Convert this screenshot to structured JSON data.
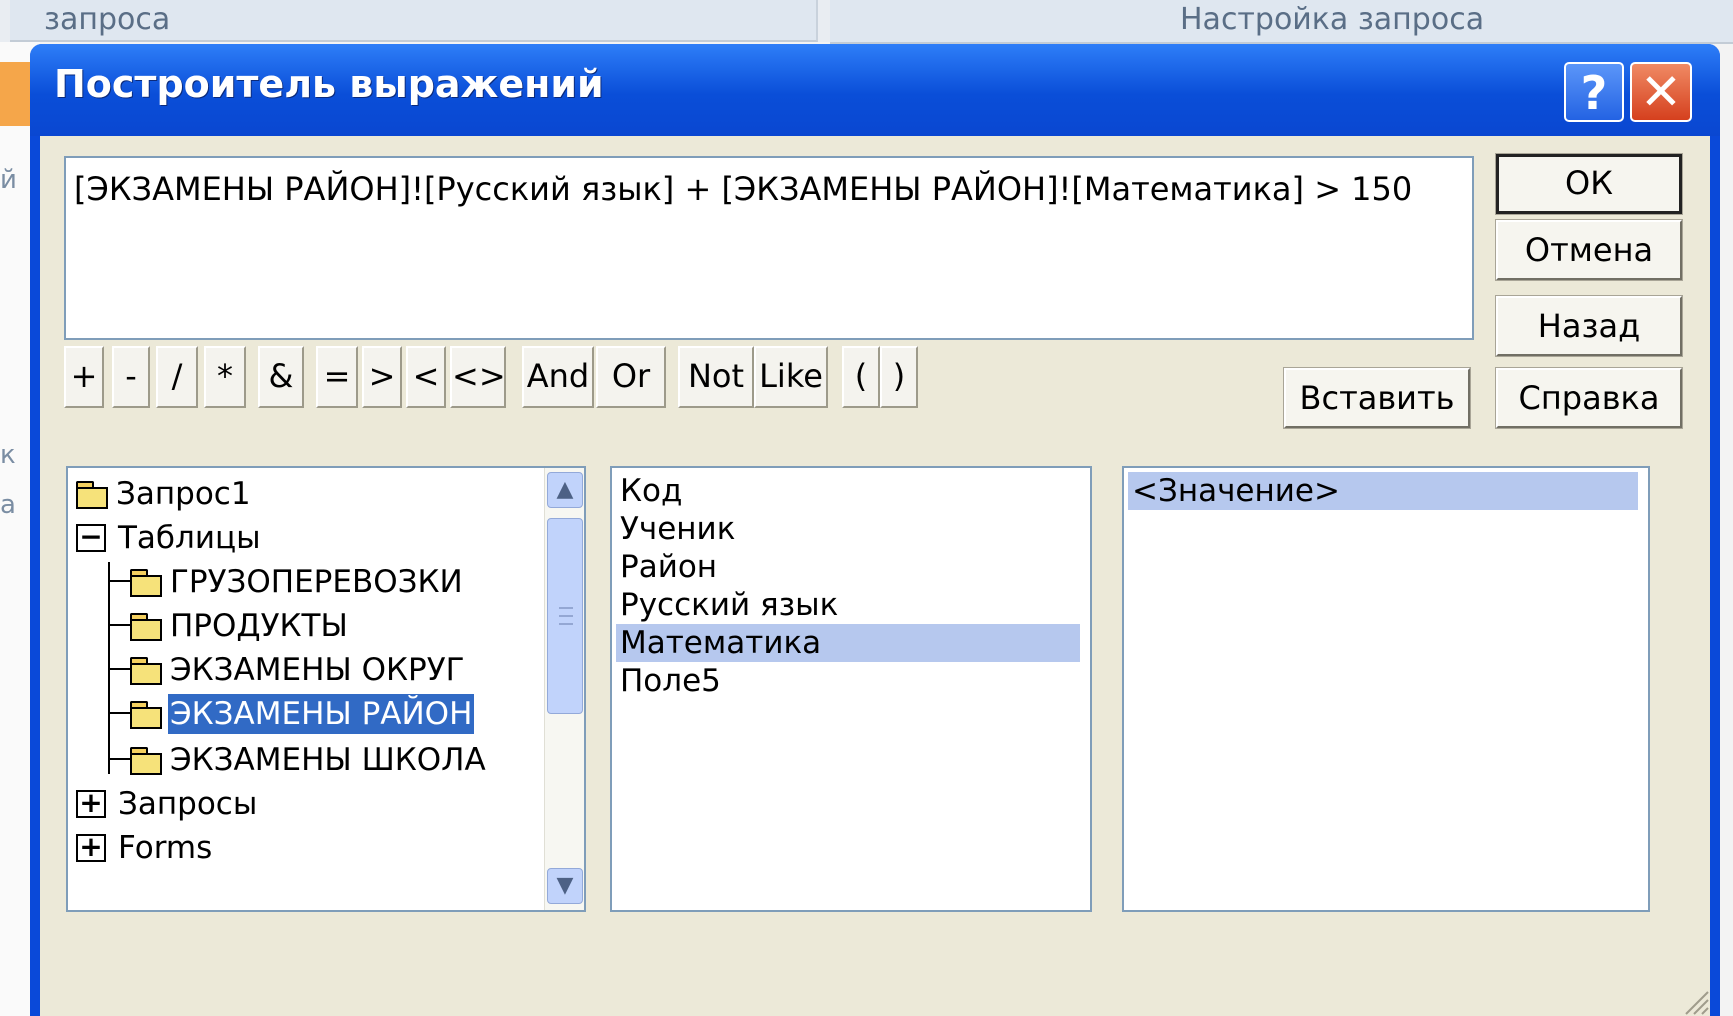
{
  "background": {
    "left_tab": "запроса",
    "right_tab": "Настройка запроса",
    "frag_1": "й",
    "frag_2": "к",
    "frag_3": "а"
  },
  "dialog": {
    "title": "Построитель выражений",
    "help_label": "?",
    "close_label": "✕"
  },
  "expression": {
    "value": "[ЭКЗАМЕНЫ РАЙОН]![Русский язык] + [ЭКЗАМЕНЫ РАЙОН]![Математика] > 150"
  },
  "buttons": {
    "ok": "ОК",
    "cancel": "Отмена",
    "back": "Назад",
    "paste": "Вставить",
    "help": "Справка"
  },
  "operators": [
    "+",
    "-",
    "/",
    "*",
    "&",
    "=",
    ">",
    "<",
    "<>",
    "And",
    "Or",
    "Not",
    "Like",
    "(",
    ")"
  ],
  "tree": {
    "items": [
      {
        "label": "Запрос1",
        "icon": "folder-icon"
      },
      {
        "label": "Таблицы",
        "icon": "collapse-icon"
      },
      {
        "label": "ГРУЗОПЕРЕВОЗКИ",
        "icon": "folder-icon"
      },
      {
        "label": "ПРОДУКТЫ",
        "icon": "folder-icon"
      },
      {
        "label": "ЭКЗАМЕНЫ ОКРУГ",
        "icon": "folder-icon"
      },
      {
        "label": "ЭКЗАМЕНЫ РАЙОН",
        "icon": "open-folder-icon",
        "selected": true
      },
      {
        "label": "ЭКЗАМЕНЫ ШКОЛА",
        "icon": "folder-icon"
      },
      {
        "label": "Запросы",
        "icon": "expand-icon"
      },
      {
        "label": "Forms",
        "icon": "expand-icon"
      }
    ]
  },
  "fields": {
    "items": [
      "Код",
      "Ученик",
      "Район",
      "Русский язык",
      "Математика",
      "Поле5"
    ],
    "selected": "Математика"
  },
  "values": {
    "items": [
      "<Значение>"
    ],
    "selected": "<Значение>"
  },
  "colors": {
    "title_blue": "#0a4ed8",
    "selection_blue": "#316ac5",
    "selection_light": "#b6c8ee",
    "dialog_face": "#ece9d8"
  }
}
